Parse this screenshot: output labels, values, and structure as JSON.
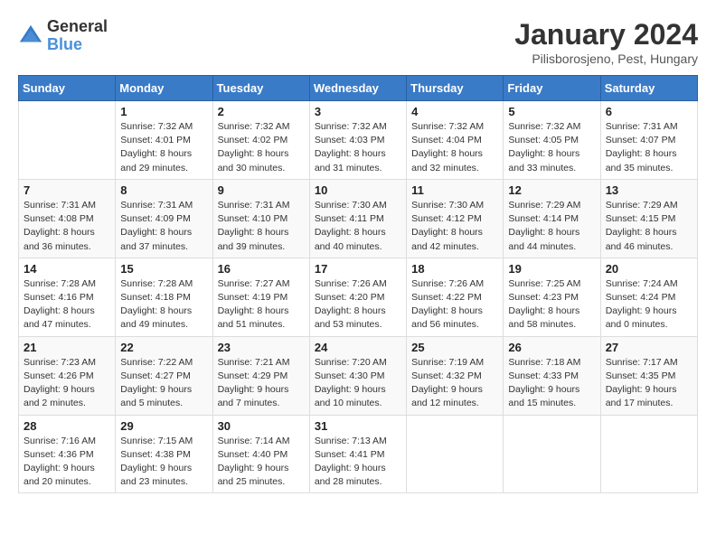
{
  "header": {
    "logo": {
      "general": "General",
      "blue": "Blue"
    },
    "title": "January 2024",
    "location": "Pilisborosjeno, Pest, Hungary"
  },
  "weekdays": [
    "Sunday",
    "Monday",
    "Tuesday",
    "Wednesday",
    "Thursday",
    "Friday",
    "Saturday"
  ],
  "weeks": [
    [
      {
        "day": "",
        "info": ""
      },
      {
        "day": "1",
        "info": "Sunrise: 7:32 AM\nSunset: 4:01 PM\nDaylight: 8 hours\nand 29 minutes."
      },
      {
        "day": "2",
        "info": "Sunrise: 7:32 AM\nSunset: 4:02 PM\nDaylight: 8 hours\nand 30 minutes."
      },
      {
        "day": "3",
        "info": "Sunrise: 7:32 AM\nSunset: 4:03 PM\nDaylight: 8 hours\nand 31 minutes."
      },
      {
        "day": "4",
        "info": "Sunrise: 7:32 AM\nSunset: 4:04 PM\nDaylight: 8 hours\nand 32 minutes."
      },
      {
        "day": "5",
        "info": "Sunrise: 7:32 AM\nSunset: 4:05 PM\nDaylight: 8 hours\nand 33 minutes."
      },
      {
        "day": "6",
        "info": "Sunrise: 7:31 AM\nSunset: 4:07 PM\nDaylight: 8 hours\nand 35 minutes."
      }
    ],
    [
      {
        "day": "7",
        "info": "Sunrise: 7:31 AM\nSunset: 4:08 PM\nDaylight: 8 hours\nand 36 minutes."
      },
      {
        "day": "8",
        "info": "Sunrise: 7:31 AM\nSunset: 4:09 PM\nDaylight: 8 hours\nand 37 minutes."
      },
      {
        "day": "9",
        "info": "Sunrise: 7:31 AM\nSunset: 4:10 PM\nDaylight: 8 hours\nand 39 minutes."
      },
      {
        "day": "10",
        "info": "Sunrise: 7:30 AM\nSunset: 4:11 PM\nDaylight: 8 hours\nand 40 minutes."
      },
      {
        "day": "11",
        "info": "Sunrise: 7:30 AM\nSunset: 4:12 PM\nDaylight: 8 hours\nand 42 minutes."
      },
      {
        "day": "12",
        "info": "Sunrise: 7:29 AM\nSunset: 4:14 PM\nDaylight: 8 hours\nand 44 minutes."
      },
      {
        "day": "13",
        "info": "Sunrise: 7:29 AM\nSunset: 4:15 PM\nDaylight: 8 hours\nand 46 minutes."
      }
    ],
    [
      {
        "day": "14",
        "info": "Sunrise: 7:28 AM\nSunset: 4:16 PM\nDaylight: 8 hours\nand 47 minutes."
      },
      {
        "day": "15",
        "info": "Sunrise: 7:28 AM\nSunset: 4:18 PM\nDaylight: 8 hours\nand 49 minutes."
      },
      {
        "day": "16",
        "info": "Sunrise: 7:27 AM\nSunset: 4:19 PM\nDaylight: 8 hours\nand 51 minutes."
      },
      {
        "day": "17",
        "info": "Sunrise: 7:26 AM\nSunset: 4:20 PM\nDaylight: 8 hours\nand 53 minutes."
      },
      {
        "day": "18",
        "info": "Sunrise: 7:26 AM\nSunset: 4:22 PM\nDaylight: 8 hours\nand 56 minutes."
      },
      {
        "day": "19",
        "info": "Sunrise: 7:25 AM\nSunset: 4:23 PM\nDaylight: 8 hours\nand 58 minutes."
      },
      {
        "day": "20",
        "info": "Sunrise: 7:24 AM\nSunset: 4:24 PM\nDaylight: 9 hours\nand 0 minutes."
      }
    ],
    [
      {
        "day": "21",
        "info": "Sunrise: 7:23 AM\nSunset: 4:26 PM\nDaylight: 9 hours\nand 2 minutes."
      },
      {
        "day": "22",
        "info": "Sunrise: 7:22 AM\nSunset: 4:27 PM\nDaylight: 9 hours\nand 5 minutes."
      },
      {
        "day": "23",
        "info": "Sunrise: 7:21 AM\nSunset: 4:29 PM\nDaylight: 9 hours\nand 7 minutes."
      },
      {
        "day": "24",
        "info": "Sunrise: 7:20 AM\nSunset: 4:30 PM\nDaylight: 9 hours\nand 10 minutes."
      },
      {
        "day": "25",
        "info": "Sunrise: 7:19 AM\nSunset: 4:32 PM\nDaylight: 9 hours\nand 12 minutes."
      },
      {
        "day": "26",
        "info": "Sunrise: 7:18 AM\nSunset: 4:33 PM\nDaylight: 9 hours\nand 15 minutes."
      },
      {
        "day": "27",
        "info": "Sunrise: 7:17 AM\nSunset: 4:35 PM\nDaylight: 9 hours\nand 17 minutes."
      }
    ],
    [
      {
        "day": "28",
        "info": "Sunrise: 7:16 AM\nSunset: 4:36 PM\nDaylight: 9 hours\nand 20 minutes."
      },
      {
        "day": "29",
        "info": "Sunrise: 7:15 AM\nSunset: 4:38 PM\nDaylight: 9 hours\nand 23 minutes."
      },
      {
        "day": "30",
        "info": "Sunrise: 7:14 AM\nSunset: 4:40 PM\nDaylight: 9 hours\nand 25 minutes."
      },
      {
        "day": "31",
        "info": "Sunrise: 7:13 AM\nSunset: 4:41 PM\nDaylight: 9 hours\nand 28 minutes."
      },
      {
        "day": "",
        "info": ""
      },
      {
        "day": "",
        "info": ""
      },
      {
        "day": "",
        "info": ""
      }
    ]
  ]
}
